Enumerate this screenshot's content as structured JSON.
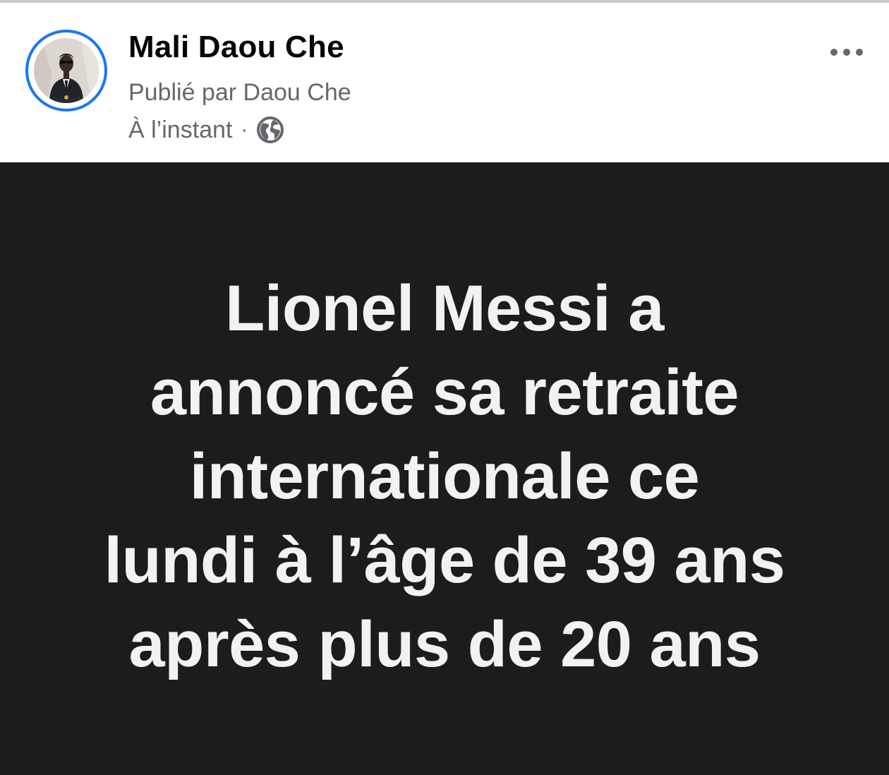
{
  "post": {
    "author_name": "Mali Daou Che",
    "published_by": "Publié par Daou Che",
    "timestamp": "À l’instant",
    "separator": "·",
    "privacy_icon": "globe-icon",
    "avatar_icon": "profile-avatar",
    "more_icon": "more-options-icon",
    "body_lines": [
      "Lionel Messi a",
      "annoncé sa retraite",
      "internationale ce",
      "lundi à l’âge de 39 ans",
      "après plus de 20 ans"
    ]
  },
  "colors": {
    "ring": "#1877f2",
    "post_background": "#1c1c1c",
    "post_text": "#f2f2f2",
    "name_text": "#050505",
    "meta_text": "#65676b"
  }
}
